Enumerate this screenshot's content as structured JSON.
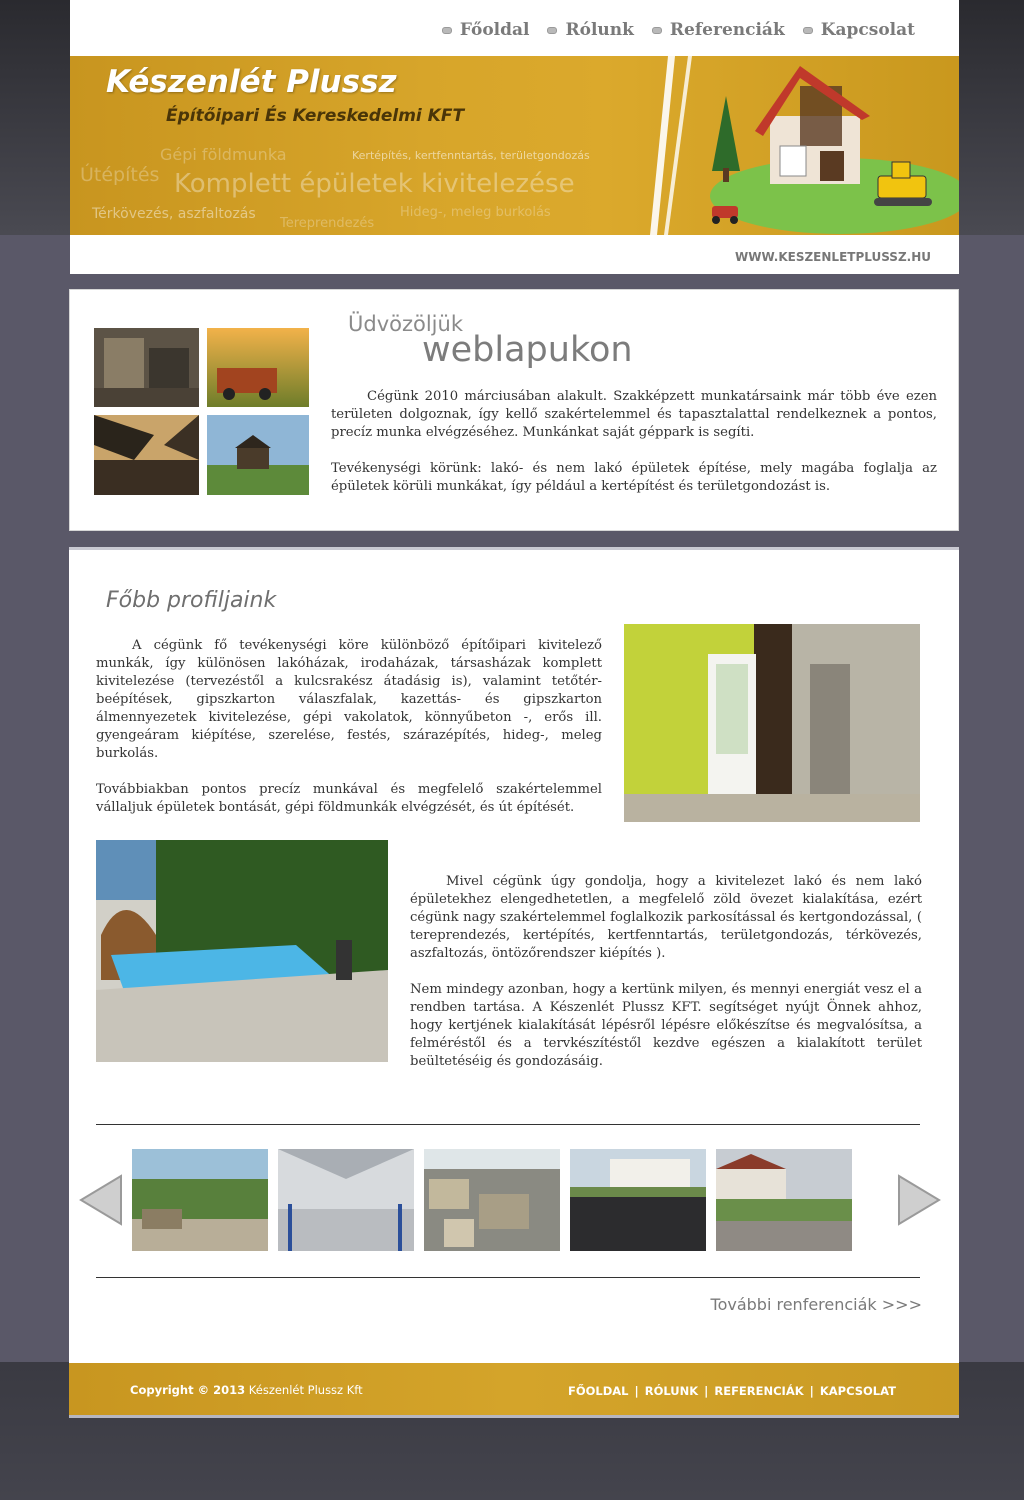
{
  "nav": {
    "items": [
      {
        "label": "Főoldal"
      },
      {
        "label": "Rólunk"
      },
      {
        "label": "Referenciák"
      },
      {
        "label": "Kapcsolat"
      }
    ]
  },
  "banner": {
    "company": "Készenlét Plussz",
    "tagline": "Építőipari És Kereskedelmi KFT",
    "words": {
      "w1": "Gépi földmunka",
      "w2": "Kertépítés, kertfenntartás, területgondozás",
      "w3": "Útépítés",
      "w4": "Komplett épületek kivitelezése",
      "w5": "Térkövezés, aszfaltozás",
      "w6": "Hideg-, meleg burkolás",
      "w7": "Tereprendezés"
    },
    "site": "WWW.KESZENLETPLUSSZ.HU"
  },
  "welcome": {
    "heading1": "Üdvözöljük",
    "heading2": "weblapukon",
    "p1": "Cégünk 2010 márciusában alakult. Szakképzett munkatársaink már több éve ezen területen dolgoznak, így kellő szakértelemmel és tapasztalattal rendelkeznek a pontos, precíz munka elvégzéséhez. Munkánkat saját géppark is segíti.",
    "p2": "Tevékenységi körünk: lakó- és nem lakó épületek építése, mely magába foglalja az épületek körüli munkákat, így például a kertépítést és területgondozást is."
  },
  "profile": {
    "title": "Főbb profiljaink",
    "p1": "A cégünk fő tevékenységi köre különböző építőipari kivitelező munkák, így különösen lakóházak, irodaházak, társasházak komplett kivitelezése (tervezéstől a kulcsrakész átadásig is), valamint tetőtér-beépítések, gipszkarton válaszfalak, kazettás- és gipszkarton álmennyezetek kivitelezése, gépi vakolatok, könnyűbeton -, erős ill. gyengeáram kiépítése, szerelése, festés, szárazépítés, hideg-, meleg burkolás.",
    "p2": "Továbbiakban pontos precíz munkával és megfelelő szakértelemmel vállaljuk épületek bontását, gépi földmunkák elvégzését, és út építését.",
    "p3": "Mivel cégünk úgy gondolja, hogy a kivitelezet lakó és nem lakó épületekhez elengedhetetlen, a megfelelő zöld övezet kialakítása, ezért cégünk nagy szakértelemmel foglalkozik parkosítással és kertgondozással, ( tereprendezés, kertépítés, kertfenntartás, területgondozás, térkövezés, aszfaltozás, öntözőrendszer kiépítés ).",
    "p4": "Nem mindegy azonban, hogy a kertünk milyen, és mennyi energiát vesz el a rendben tartása. A Készenlét Plussz KFT. segítséget nyújt Önnek ahhoz, hogy kertjének kialakítását lépésről lépésre előkészítse és megvalósítsa, a felméréstől és a tervkészítéstől kezdve egészen a kialakított terület beültetéséig és gondozásáig."
  },
  "gallery": {
    "more": "További renferenciák >>>"
  },
  "footer": {
    "copyright_bold": "Copyright © 2013",
    "copyright_name": "Készenlét Plussz Kft",
    "links": [
      "FŐOLDAL",
      "RÓLUNK",
      "REFERENCIÁK",
      "KAPCSOLAT"
    ],
    "separator": "|"
  }
}
